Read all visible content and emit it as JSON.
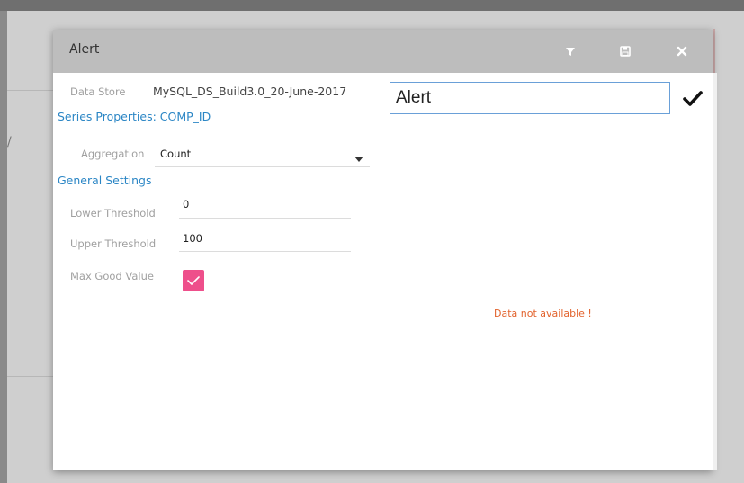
{
  "dialog": {
    "title": "Alert",
    "header_icons": [
      "filter-icon",
      "save-icon",
      "close-icon"
    ]
  },
  "data_store": {
    "label": "Data Store",
    "value": "MySQL_DS_Build3.0_20-June-2017"
  },
  "title_input": {
    "value": "Alert"
  },
  "series_properties": {
    "title": "Series Properties: COMP_ID",
    "aggregation_label": "Aggregation",
    "aggregation_value": "Count"
  },
  "general_settings": {
    "title": "General Settings",
    "lower_threshold_label": "Lower Threshold",
    "lower_threshold_value": "0",
    "upper_threshold_label": "Upper Threshold",
    "upper_threshold_value": "100",
    "max_good_value_label": "Max Good Value",
    "max_good_value_checked": true
  },
  "preview": {
    "message": "Data not available !"
  },
  "colors": {
    "accent_blue": "#2b86c5",
    "checkbox_pink": "#ee4f8b",
    "error_orange": "#e2622c",
    "header_gray": "#bdbdbd"
  }
}
